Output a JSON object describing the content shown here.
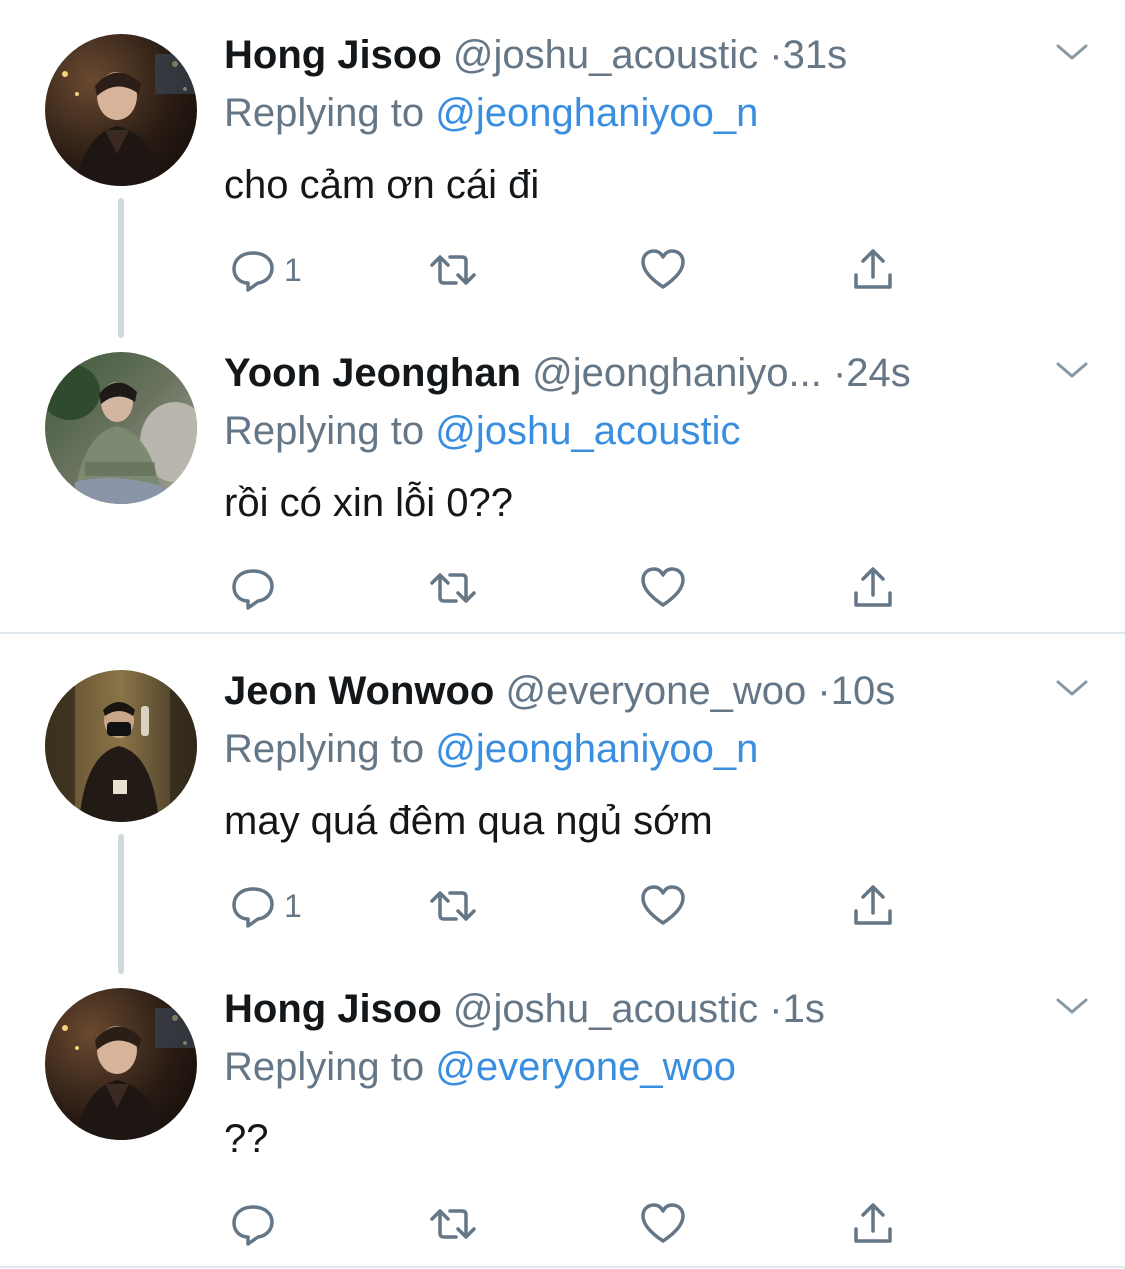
{
  "colors": {
    "name": "#14171a",
    "secondary": "#657786",
    "mention": "#3a8ee0",
    "thread_line": "#cfd9de",
    "divider": "#e1e8ed"
  },
  "tweets": [
    {
      "name": "Hong Jisoo",
      "handle": "@joshu_acoustic",
      "dot": "·",
      "time": "31s",
      "replying_prefix": "Replying to ",
      "replying_to": "@jeonghaniyoo_n",
      "text": "cho cảm ơn cái đi",
      "reply_count": "1",
      "avatar_icon": "avatar-photo"
    },
    {
      "name": "Yoon Jeonghan",
      "handle": "@jeonghaniyo...",
      "dot": " ·",
      "time": "24s",
      "replying_prefix": "Replying to ",
      "replying_to": "@joshu_acoustic",
      "text": "rồi có xin lỗi 0??",
      "reply_count": "",
      "avatar_icon": "avatar-photo"
    },
    {
      "name": "Jeon Wonwoo",
      "handle": "@everyone_woo",
      "dot": "·",
      "time": "10s",
      "replying_prefix": "Replying to ",
      "replying_to": "@jeonghaniyoo_n",
      "text": "may quá đêm qua ngủ sớm",
      "reply_count": "1",
      "avatar_icon": "avatar-photo"
    },
    {
      "name": "Hong Jisoo",
      "handle": "@joshu_acoustic",
      "dot": "·",
      "time": "1s",
      "replying_prefix": "Replying to ",
      "replying_to": "@everyone_woo",
      "text": "??",
      "reply_count": "",
      "avatar_icon": "avatar-photo"
    }
  ],
  "action_icons": [
    "reply-icon",
    "retweet-icon",
    "like-icon",
    "share-icon",
    "chevron-down-icon"
  ]
}
